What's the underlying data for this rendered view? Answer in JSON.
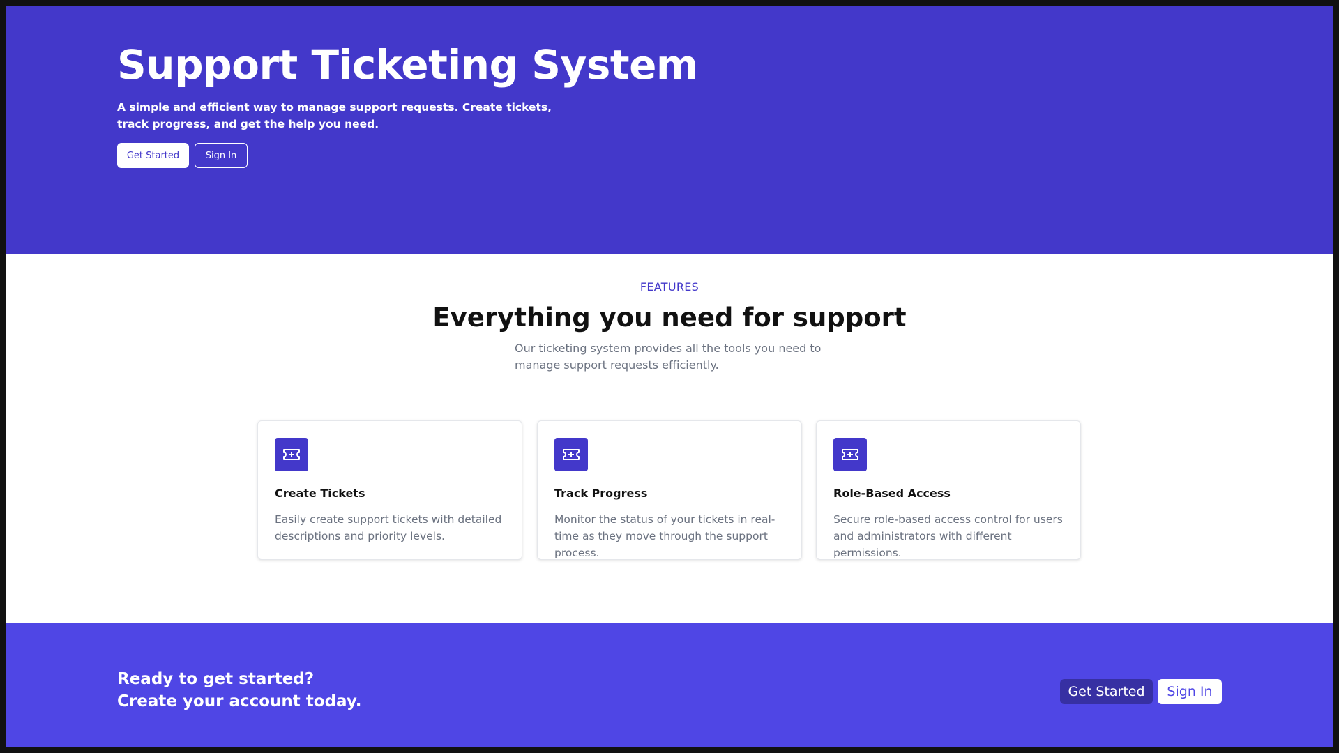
{
  "hero": {
    "title": "Support Ticketing System",
    "subtitle": "A simple and efficient way to manage support requests. Create tickets, track progress, and get the help you need.",
    "get_started_label": "Get Started",
    "sign_in_label": "Sign In"
  },
  "features": {
    "kicker": "FEATURES",
    "title": "Everything you need for support",
    "subtitle": "Our ticketing system provides all the tools you need to manage support requests efficiently.",
    "cards": [
      {
        "icon": "ticket-icon",
        "title": "Create Tickets",
        "description": "Easily create support tickets with detailed descriptions and priority levels."
      },
      {
        "icon": "ticket-icon",
        "title": "Track Progress",
        "description": "Monitor the status of your tickets in real-time as they move through the support process."
      },
      {
        "icon": "ticket-icon",
        "title": "Role-Based Access",
        "description": "Secure role-based access control for users and administrators with different permissions."
      }
    ]
  },
  "cta": {
    "line1": "Ready to get started?",
    "line2": "Create your account today.",
    "get_started_label": "Get Started",
    "sign_in_label": "Sign In"
  },
  "colors": {
    "hero_bg": "#4338ca",
    "cta_bg": "#4f46e5",
    "accent": "#4338ca",
    "muted_text": "#6b7280"
  }
}
